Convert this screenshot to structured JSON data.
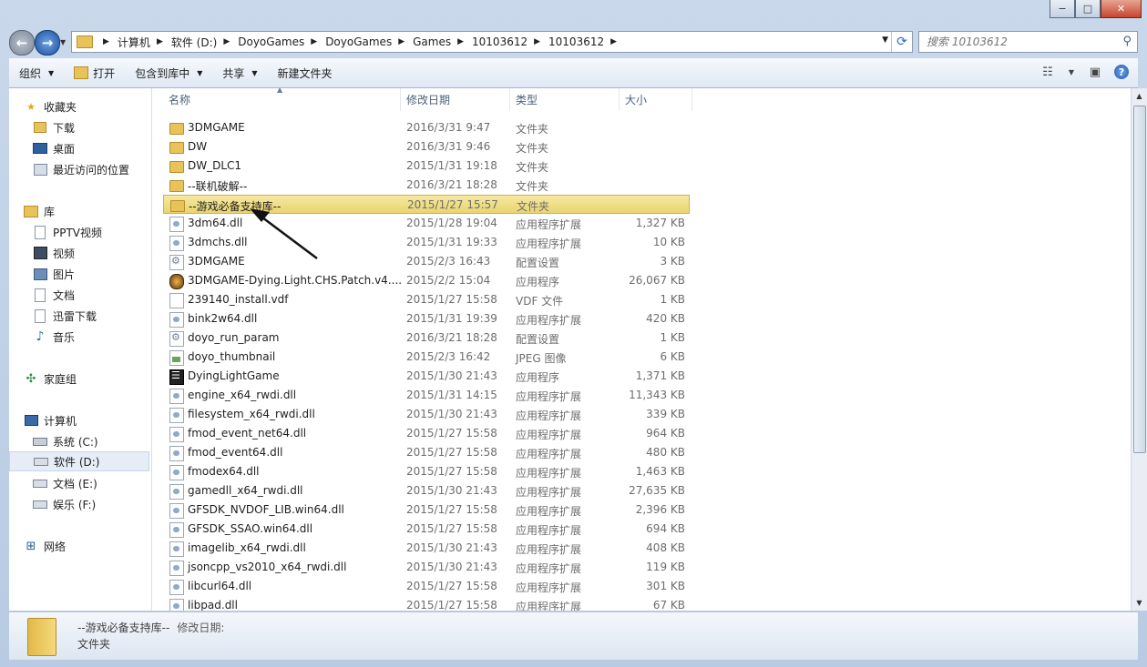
{
  "window": {
    "minimize_glyph": "−",
    "maximize_glyph": "□",
    "close_glyph": "✕"
  },
  "address": {
    "crumbs": [
      "计算机",
      "软件 (D:)",
      "DoyoGames",
      "DoyoGames",
      "Games",
      "10103612",
      "10103612"
    ]
  },
  "search": {
    "placeholder": "搜索 10103612"
  },
  "toolbar": {
    "organize": "组织",
    "open": "打开",
    "include_library": "包含到库中",
    "share": "共享",
    "new_folder": "新建文件夹"
  },
  "navpane": {
    "favorites": "收藏夹",
    "downloads": "下载",
    "desktop": "桌面",
    "recent": "最近访问的位置",
    "libraries": "库",
    "pptv": "PPTV视频",
    "videos": "视频",
    "pictures": "图片",
    "documents": "文档",
    "xunlei": "迅雷下载",
    "music": "音乐",
    "homegroup": "家庭组",
    "computer": "计算机",
    "drive_c": "系统 (C:)",
    "drive_d": "软件 (D:)",
    "drive_e": "文档 (E:)",
    "drive_f": "娱乐 (F:)",
    "network": "网络"
  },
  "columns": {
    "name": "名称",
    "date": "修改日期",
    "type": "类型",
    "size": "大小"
  },
  "files": [
    {
      "name": "3DMGAME",
      "date": "2016/3/31 9:47",
      "type": "文件夹",
      "size": "",
      "icon": "folder-icon"
    },
    {
      "name": "DW",
      "date": "2016/3/31 9:46",
      "type": "文件夹",
      "size": "",
      "icon": "folder-icon"
    },
    {
      "name": "DW_DLC1",
      "date": "2015/1/31 19:18",
      "type": "文件夹",
      "size": "",
      "icon": "folder-icon"
    },
    {
      "name": "--联机破解--",
      "date": "2016/3/21 18:28",
      "type": "文件夹",
      "size": "",
      "icon": "folder-icon"
    },
    {
      "name": "--游戏必备支持库--",
      "date": "2015/1/27 15:57",
      "type": "文件夹",
      "size": "",
      "icon": "folder-icon",
      "selected": true
    },
    {
      "name": "3dm64.dll",
      "date": "2015/1/28 19:04",
      "type": "应用程序扩展",
      "size": "1,327 KB",
      "icon": "dll-icon"
    },
    {
      "name": "3dmchs.dll",
      "date": "2015/1/31 19:33",
      "type": "应用程序扩展",
      "size": "10 KB",
      "icon": "dll-icon"
    },
    {
      "name": "3DMGAME",
      "date": "2015/2/3 16:43",
      "type": "配置设置",
      "size": "3 KB",
      "icon": "config-icon"
    },
    {
      "name": "3DMGAME-Dying.Light.CHS.Patch.v4....",
      "date": "2015/2/2 15:04",
      "type": "应用程序",
      "size": "26,067 KB",
      "icon": "exe-icon"
    },
    {
      "name": "239140_install.vdf",
      "date": "2015/1/27 15:58",
      "type": "VDF 文件",
      "size": "1 KB",
      "icon": "document-icon"
    },
    {
      "name": "bink2w64.dll",
      "date": "2015/1/31 19:39",
      "type": "应用程序扩展",
      "size": "420 KB",
      "icon": "dll-icon"
    },
    {
      "name": "doyo_run_param",
      "date": "2016/3/21 18:28",
      "type": "配置设置",
      "size": "1 KB",
      "icon": "config-icon"
    },
    {
      "name": "doyo_thumbnail",
      "date": "2015/2/3 16:42",
      "type": "JPEG 图像",
      "size": "6 KB",
      "icon": "image-icon"
    },
    {
      "name": "DyingLightGame",
      "date": "2015/1/30 21:43",
      "type": "应用程序",
      "size": "1,371 KB",
      "icon": "game-exe-icon"
    },
    {
      "name": "engine_x64_rwdi.dll",
      "date": "2015/1/31 14:15",
      "type": "应用程序扩展",
      "size": "11,343 KB",
      "icon": "dll-icon"
    },
    {
      "name": "filesystem_x64_rwdi.dll",
      "date": "2015/1/30 21:43",
      "type": "应用程序扩展",
      "size": "339 KB",
      "icon": "dll-icon"
    },
    {
      "name": "fmod_event_net64.dll",
      "date": "2015/1/27 15:58",
      "type": "应用程序扩展",
      "size": "964 KB",
      "icon": "dll-icon"
    },
    {
      "name": "fmod_event64.dll",
      "date": "2015/1/27 15:58",
      "type": "应用程序扩展",
      "size": "480 KB",
      "icon": "dll-icon"
    },
    {
      "name": "fmodex64.dll",
      "date": "2015/1/27 15:58",
      "type": "应用程序扩展",
      "size": "1,463 KB",
      "icon": "dll-icon"
    },
    {
      "name": "gamedll_x64_rwdi.dll",
      "date": "2015/1/30 21:43",
      "type": "应用程序扩展",
      "size": "27,635 KB",
      "icon": "dll-icon"
    },
    {
      "name": "GFSDK_NVDOF_LIB.win64.dll",
      "date": "2015/1/27 15:58",
      "type": "应用程序扩展",
      "size": "2,396 KB",
      "icon": "dll-icon"
    },
    {
      "name": "GFSDK_SSAO.win64.dll",
      "date": "2015/1/27 15:58",
      "type": "应用程序扩展",
      "size": "694 KB",
      "icon": "dll-icon"
    },
    {
      "name": "imagelib_x64_rwdi.dll",
      "date": "2015/1/30 21:43",
      "type": "应用程序扩展",
      "size": "408 KB",
      "icon": "dll-icon"
    },
    {
      "name": "jsoncpp_vs2010_x64_rwdi.dll",
      "date": "2015/1/30 21:43",
      "type": "应用程序扩展",
      "size": "119 KB",
      "icon": "dll-icon"
    },
    {
      "name": "libcurl64.dll",
      "date": "2015/1/27 15:58",
      "type": "应用程序扩展",
      "size": "301 KB",
      "icon": "dll-icon"
    },
    {
      "name": "libpad.dll",
      "date": "2015/1/27 15:58",
      "type": "应用程序扩展",
      "size": "67 KB",
      "icon": "dll-icon"
    }
  ],
  "details": {
    "name": "--游戏必备支持库--",
    "date_label": "修改日期:",
    "type": "文件夹"
  }
}
